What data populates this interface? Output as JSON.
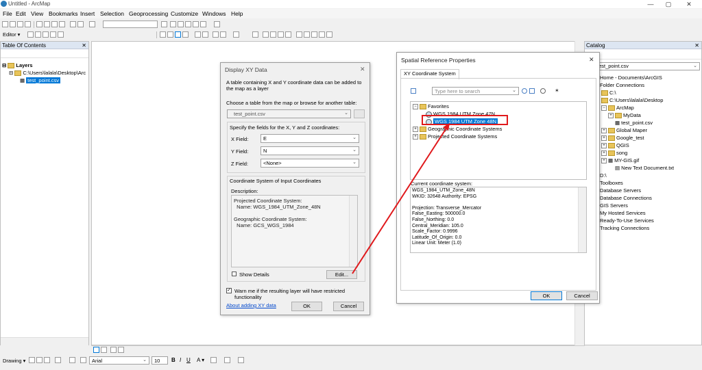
{
  "window": {
    "title": "Untitled - ArcMap",
    "minimize": "—",
    "maximize": "▢",
    "close": "✕"
  },
  "menu": [
    "File",
    "Edit",
    "View",
    "Bookmarks",
    "Insert",
    "Selection",
    "Geoprocessing",
    "Customize",
    "Windows",
    "Help"
  ],
  "toolbar": {
    "editor_label": "Editor ▾",
    "scale_value": ""
  },
  "toc": {
    "title": "Table Of Contents",
    "layers_label": "Layers",
    "path": "C:\\Users\\lalala\\Desktop\\Arc",
    "layer": "test_point.csv"
  },
  "catalog": {
    "title": "Catalog",
    "location_label": "n:",
    "location_value": "test_point.csv",
    "items": [
      "Home - Documents\\ArcGIS",
      "Folder Connections",
      "C:\\",
      "C:\\Users\\lalala\\Desktop",
      "ArcMap",
      "MyData",
      "test_point.csv",
      "Global Maper",
      "Google_test",
      "QGIS",
      "song",
      "MY-GIS.gif",
      "New Text Document.txt",
      "D:\\",
      "Toolboxes",
      "Database Servers",
      "Database Connections",
      "GIS Servers",
      "My Hosted Services",
      "Ready-To-Use Services",
      "Tracking Connections"
    ]
  },
  "xy_dialog": {
    "title": "Display XY Data",
    "close": "✕",
    "intro": "A table containing X and Y coordinate data can be added to the map as a layer",
    "choose_label": "Choose a table from the map or browse for another table:",
    "table_value": "test_point.csv",
    "fields_label": "Specify the fields for the X, Y and Z coordinates:",
    "x_label": "X Field:",
    "x_value": "E",
    "y_label": "Y Field:",
    "y_value": "N",
    "z_label": "Z Field:",
    "z_value": "<None>",
    "coord_group": "Coordinate System of Input Coordinates",
    "description_label": "Description:",
    "desc_lines": [
      "Projected Coordinate System:",
      "  Name: WGS_1984_UTM_Zone_48N",
      "",
      "Geographic Coordinate System:",
      "  Name: GCS_WGS_1984"
    ],
    "show_details": "Show Details",
    "edit_button": "Edit...",
    "warn_text": "Warn me if the resulting layer will have restricted functionality",
    "about_link": "About adding XY data",
    "ok": "OK",
    "cancel": "Cancel"
  },
  "srp_dialog": {
    "title": "Spatial Reference Properties",
    "close": "✕",
    "tab": "XY Coordinate System",
    "search_placeholder": "Type here to search",
    "tree": {
      "favorites": "Favorites",
      "item1": "WGS 1984 UTM Zone 47N",
      "item2": "WGS 1984 UTM Zone 48N",
      "geographic": "Geographic Coordinate Systems",
      "projected": "Projected Coordinate Systems"
    },
    "current_label": "Current coordinate system:",
    "current_lines": [
      "WGS_1984_UTM_Zone_48N",
      "WKID: 32648 Authority: EPSG",
      "",
      "Projection: Transverse_Mercator",
      "False_Easting: 500000.0",
      "False_Northing: 0.0",
      "Central_Meridian: 105.0",
      "Scale_Factor: 0.9996",
      "Latitude_Of_Origin: 0.0",
      "Linear Unit: Meter (1.0)"
    ],
    "ok": "OK",
    "cancel": "Cancel"
  },
  "drawing": {
    "label": "Drawing ▾",
    "font": "Arial",
    "size": "10",
    "bold": "B",
    "italic": "I",
    "underline": "U",
    "font_color": "A ▾"
  },
  "colors": {
    "highlight": "#e0191c",
    "selection": "#0078d7"
  }
}
